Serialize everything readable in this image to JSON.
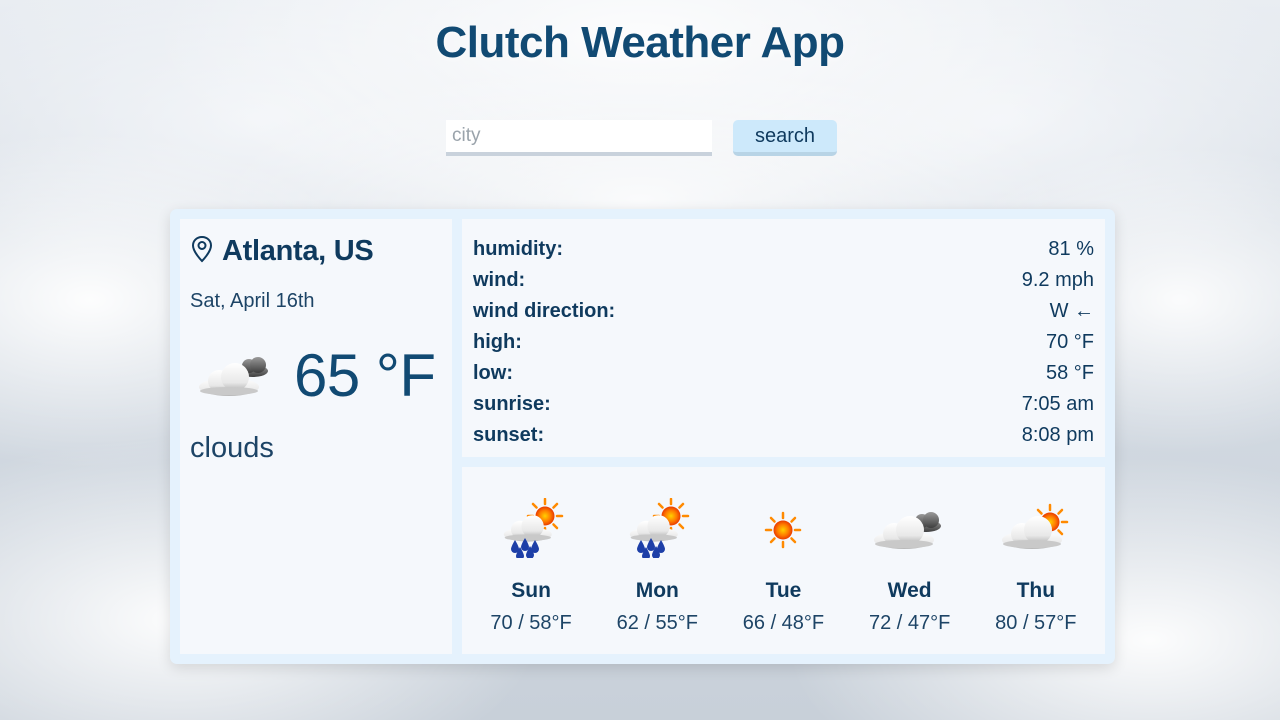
{
  "app": {
    "title": "Clutch Weather App"
  },
  "search": {
    "placeholder": "city",
    "value": "",
    "button_label": "search"
  },
  "current": {
    "location": "Atlanta, US",
    "date": "Sat, April 16th",
    "temperature": "65 °F",
    "condition": "clouds",
    "icon": "cloudy-icon"
  },
  "details": [
    {
      "label": "humidity:",
      "value": "81 %"
    },
    {
      "label": "wind:",
      "value": "9.2 mph"
    },
    {
      "label": "wind direction:",
      "value": "W ←"
    },
    {
      "label": "high:",
      "value": "70 °F"
    },
    {
      "label": "low:",
      "value": "58 °F"
    },
    {
      "label": "sunrise:",
      "value": "7:05 am"
    },
    {
      "label": "sunset:",
      "value": "8:08 pm"
    }
  ],
  "forecast": [
    {
      "day": "Sun",
      "temps": "70 / 58°F",
      "icon": "rain-sun-icon"
    },
    {
      "day": "Mon",
      "temps": "62 / 55°F",
      "icon": "rain-sun-icon"
    },
    {
      "day": "Tue",
      "temps": "66 / 48°F",
      "icon": "sun-icon"
    },
    {
      "day": "Wed",
      "temps": "72 / 47°F",
      "icon": "cloudy-icon"
    },
    {
      "day": "Thu",
      "temps": "80 / 57°F",
      "icon": "partly-sunny-icon"
    }
  ],
  "colors": {
    "title": "#114a73",
    "text": "#0f3a5e",
    "card": "#e5f2fd",
    "panel": "#f5f8fc",
    "button": "#cde9fb",
    "sun": "#ff6a00",
    "rain": "#1d3fa8"
  }
}
